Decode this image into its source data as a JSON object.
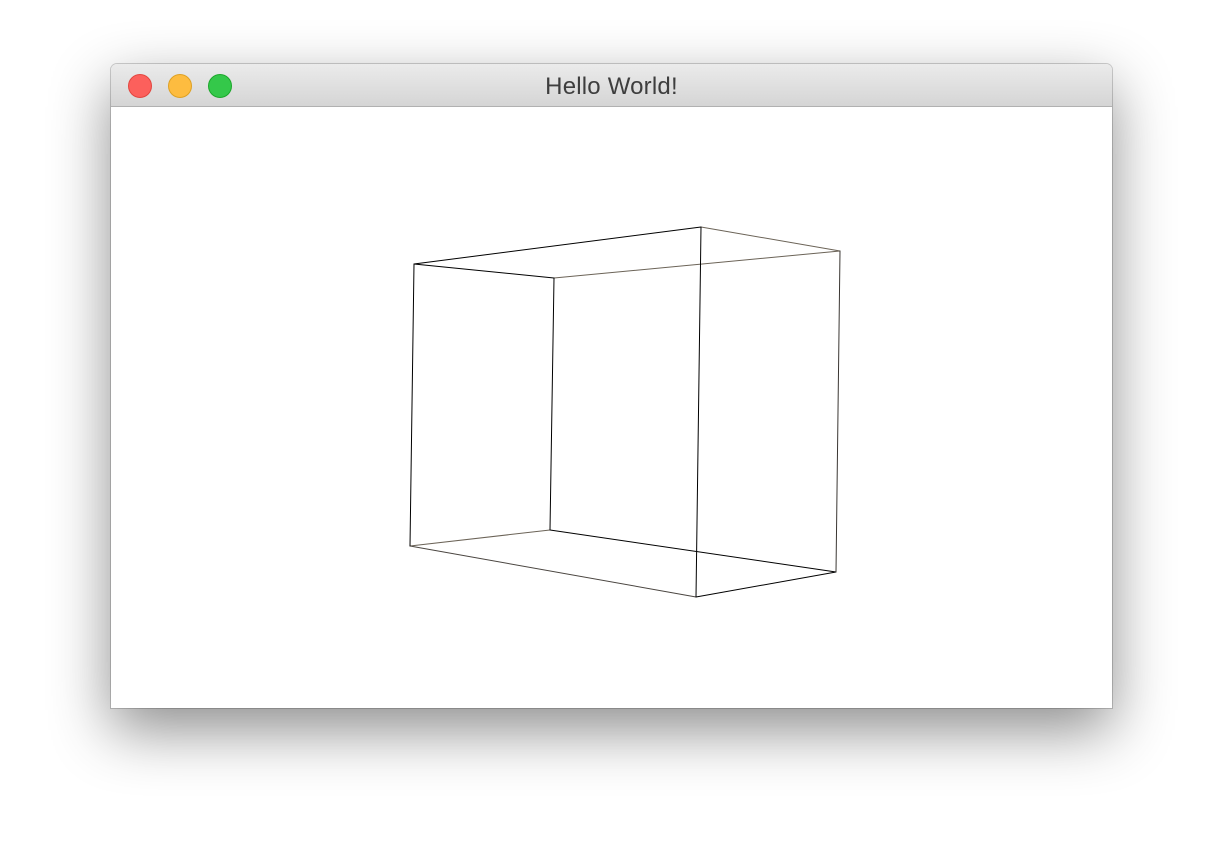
{
  "window": {
    "title": "Hello World!",
    "controls": {
      "close": {
        "icon": "close-icon",
        "color": "#fc605c"
      },
      "minimize": {
        "icon": "minimize-icon",
        "color": "#fdbc40"
      },
      "maximize": {
        "icon": "maximize-icon",
        "color": "#34c84a"
      }
    }
  },
  "scene": {
    "object": "wireframe-cube",
    "stroke_color": "#000000",
    "background": "#ffffff"
  }
}
